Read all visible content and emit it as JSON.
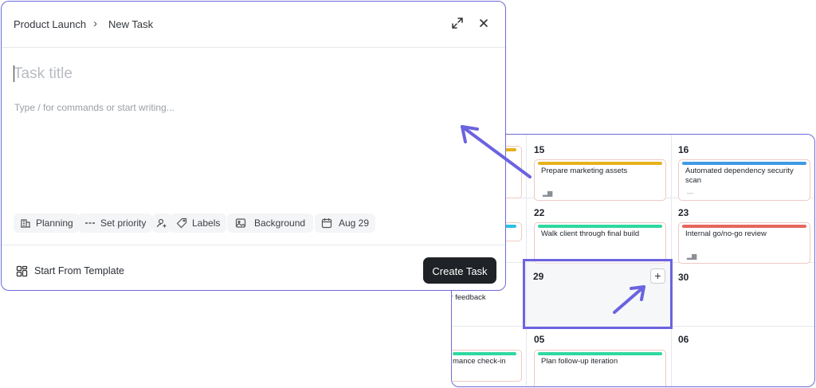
{
  "modal": {
    "breadcrumb": {
      "project": "Product Launch",
      "separator": "›",
      "current": "New Task"
    },
    "title_placeholder": "Task title",
    "description_placeholder": "Type / for commands or start writing...",
    "chips": {
      "status": "Planning",
      "priority": "Set priority",
      "labels": "Labels",
      "background": "Background",
      "date": "Aug 29"
    },
    "template_label": "Start From Template",
    "create_label": "Create Task"
  },
  "calendar": {
    "days": {
      "d15": "15",
      "d16": "16",
      "d22": "22",
      "d23": "23",
      "d29": "29",
      "d30": "30",
      "d05": "05",
      "d06": "06"
    },
    "events": {
      "prepare_marketing": "Prepare marketing assets",
      "dependency_scan": "Automated dependency security scan",
      "walk_client": "Walk client through final build",
      "go_no_go": "Internal go/no-go review",
      "feedback_cut": "er feedback",
      "performance_cut": "mance check-in",
      "follow_up": "Plan follow-up iteration"
    },
    "add_button": "+"
  },
  "colors": {
    "accent": "#6b63e0",
    "yellow": "#e6b21c",
    "blue": "#3f9ae6",
    "green": "#2fd8a0",
    "red": "#e5675d",
    "primary_button": "#1f2226"
  }
}
